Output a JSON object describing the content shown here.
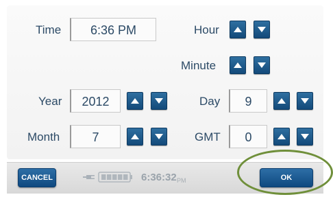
{
  "labels": {
    "time": "Time",
    "hour": "Hour",
    "minute": "Minute",
    "year": "Year",
    "day": "Day",
    "month": "Month",
    "gmt": "GMT"
  },
  "values": {
    "time": "6:36 PM",
    "year": "2012",
    "day": "9",
    "month": "7",
    "gmt": "0"
  },
  "footer": {
    "cancel_label": "CANCEL",
    "ok_label": "OK",
    "clock_time": "6:36:32",
    "clock_ampm": "PM"
  },
  "colors": {
    "accent_blue": "#1a578c",
    "label_text": "#2c4a66",
    "highlight_ring": "#6f8f3a"
  },
  "icons": [
    "arrow-up-icon",
    "arrow-down-icon",
    "plug-icon",
    "battery-icon"
  ]
}
